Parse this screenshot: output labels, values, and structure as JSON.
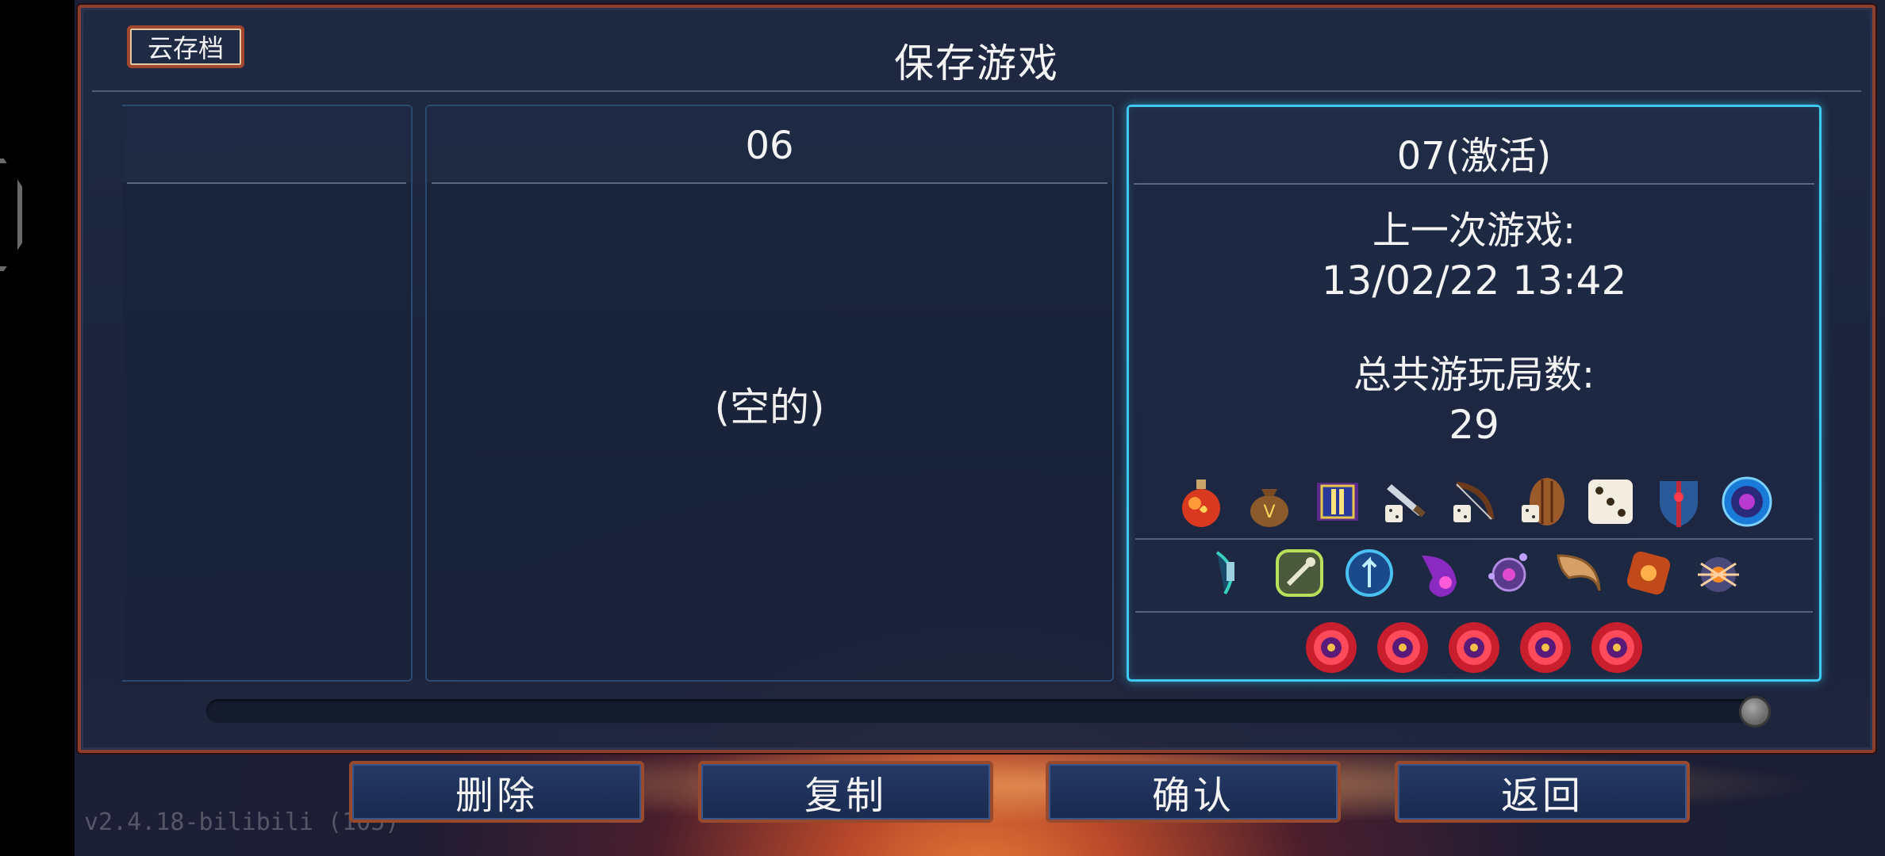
{
  "header": {
    "cloud_save_label": "云存档",
    "title": "保存游戏"
  },
  "slots": {
    "slot06": {
      "title": "06",
      "empty_label": "(空的)"
    },
    "slot07": {
      "title": "07(激活)",
      "last_played_label": "上一次游戏:",
      "last_played_value": "13/02/22  13:42",
      "total_runs_label": "总共游玩局数:",
      "total_runs_value": "29",
      "icons_row1": [
        "red-potion-icon",
        "gold-bag-icon",
        "scroll-icon",
        "dagger-dice-icon",
        "bow-dice-icon",
        "shield-dice-icon",
        "dice-icon",
        "blue-shield-icon",
        "blue-orb-icon"
      ],
      "icons_row2": [
        "wrist-rune-icon",
        "wrench-rune-icon",
        "arrow-rune-icon",
        "purple-flame-icon",
        "purple-eye-icon",
        "horn-icon",
        "orange-amulet-icon",
        "spider-icon"
      ],
      "icons_row3": [
        "boss-cell-icon",
        "boss-cell-icon",
        "boss-cell-icon",
        "boss-cell-icon",
        "boss-cell-icon"
      ]
    }
  },
  "scrollbar": {
    "position": 1.0
  },
  "buttons": {
    "delete": "删除",
    "copy": "复制",
    "confirm": "确认",
    "back": "返回"
  },
  "version_text": "v2.4.18-bilibili (105)"
}
